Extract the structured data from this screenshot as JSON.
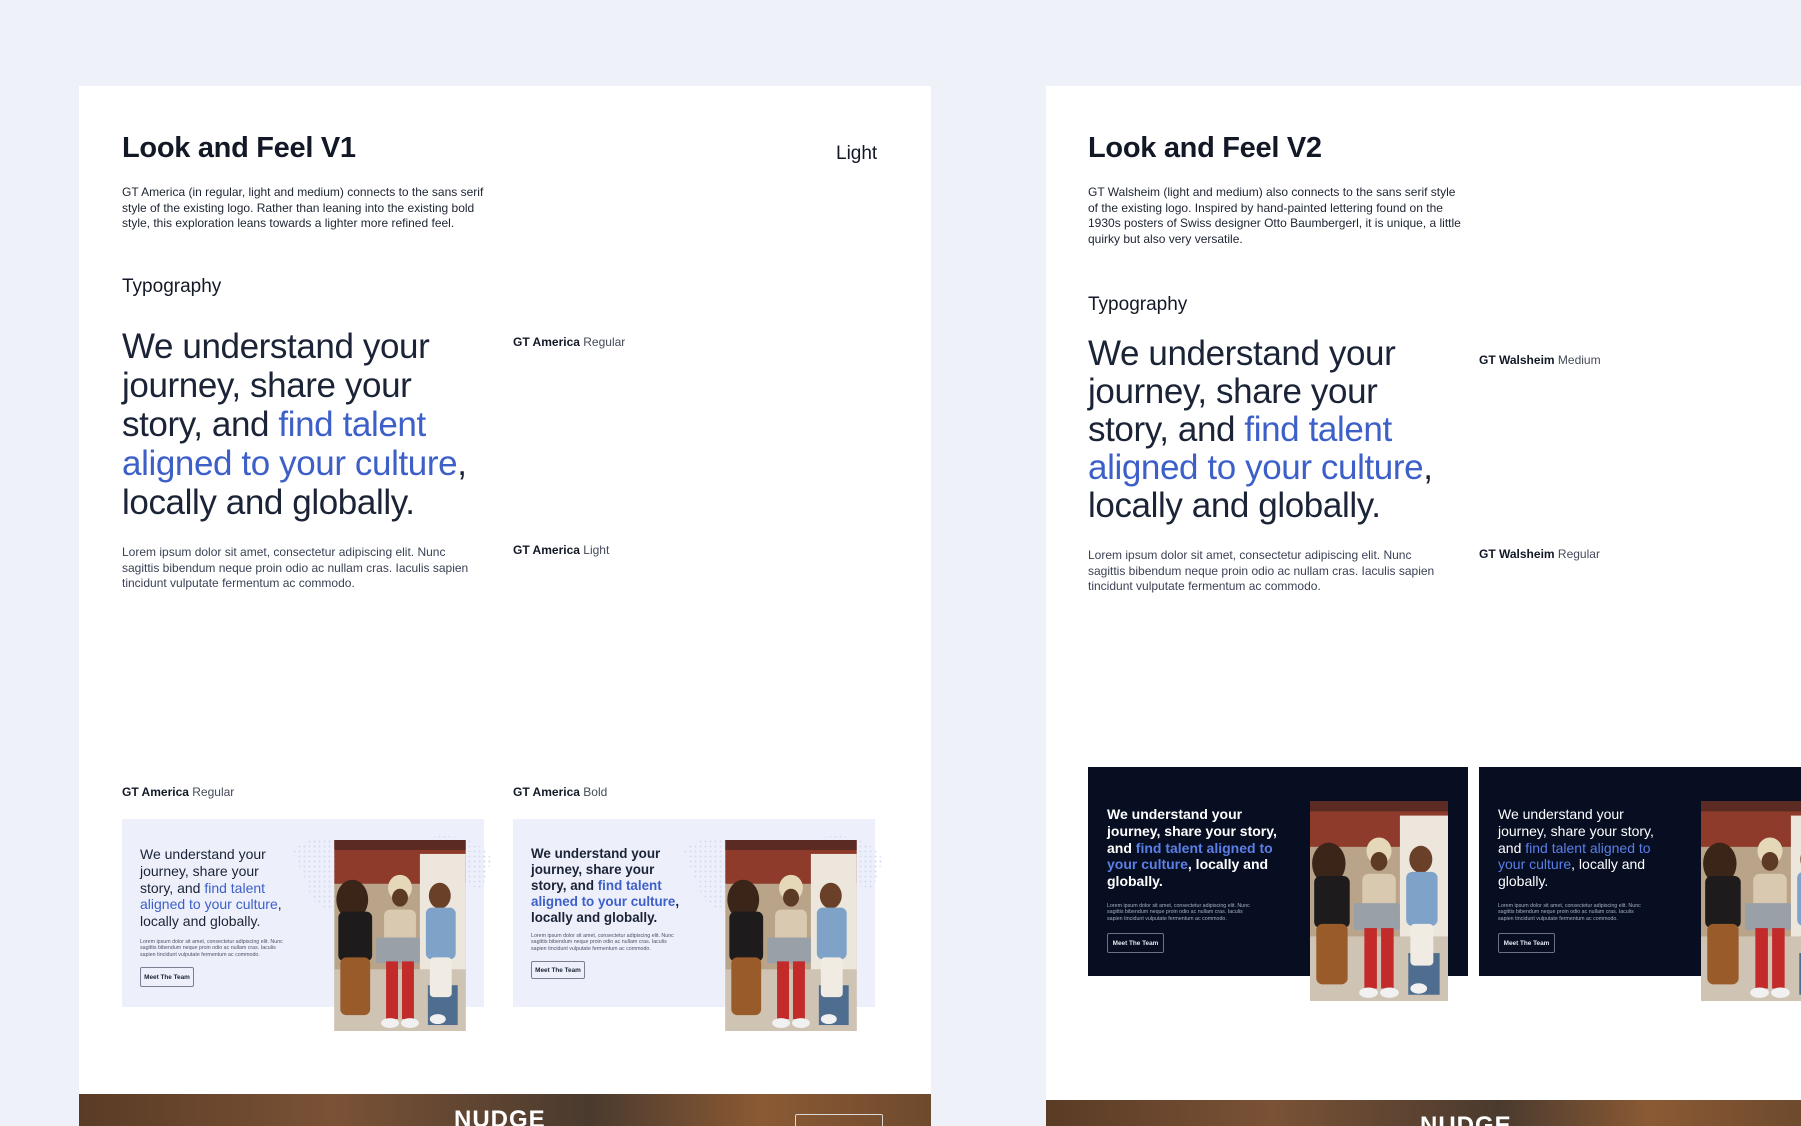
{
  "colors": {
    "canvas": "#eef2f8",
    "board": "#ffffff",
    "text": "#121826",
    "accent": "#3d5fc8",
    "accent_on_dark": "#5b7fe6",
    "light_card": "#edf0fb",
    "dark_card": "#070e22"
  },
  "v1": {
    "title": "Look and Feel V1",
    "mode": "Light",
    "intro": "GT America (in regular, light and medium) connects to the sans serif style of the existing logo. Rather than leaning into the existing bold style, this exploration leans towards a lighter more refined feel.",
    "section": "Typography",
    "headline": {
      "part1": "We understand your journey, share your story, and ",
      "highlight": "find talent aligned to your culture",
      "part2": ", locally and globally."
    },
    "headline_font": {
      "family": "GT America",
      "weight": "Regular"
    },
    "body": "Lorem ipsum dolor sit amet, consectetur adipiscing elit. Nunc sagittis bibendum neque proin odio ac nullam cras. Iaculis sapien tincidunt vulputate fermentum ac commodo.",
    "body_font": {
      "family": "GT America",
      "weight": "Light"
    },
    "cards": [
      {
        "family": "GT America",
        "weight": "Regular"
      },
      {
        "family": "GT America",
        "weight": "Bold"
      }
    ]
  },
  "v2": {
    "title": "Look and Feel V2",
    "intro": "GT Walsheim (light and medium) also connects to the sans serif style of the existing logo. Inspired by hand-painted lettering found on the 1930s posters of Swiss designer Otto Baumbergerl, it is unique, a little quirky but also very versatile.",
    "section": "Typography",
    "headline": {
      "part1": "We understand your journey, share your story, and ",
      "highlight": "find talent aligned to your culture",
      "part2": ", locally and globally."
    },
    "headline_font": {
      "family": "GT Walsheim",
      "weight": "Medium"
    },
    "body": "Lorem ipsum dolor sit amet, consectetur adipiscing elit. Nunc sagittis bibendum neque proin odio ac nullam cras. Iaculis sapien tincidunt vulputate fermentum ac commodo.",
    "body_font": {
      "family": "GT Walsheim",
      "weight": "Regular"
    }
  },
  "card": {
    "headline_part1": "We understand your journey, share your story, and ",
    "headline_highlight": "find talent aligned to your culture",
    "headline_part2": ", locally and globally.",
    "body": "Lorem ipsum dolor sit amet, consectetur adipiscing elit. Nunc sagittis bibendum neque proin odio ac nullam cras. Iaculis sapien tincidunt vulputate fermentum ac commodo.",
    "button": "Meet The Team"
  },
  "footer": {
    "logo": "NUDGE"
  }
}
